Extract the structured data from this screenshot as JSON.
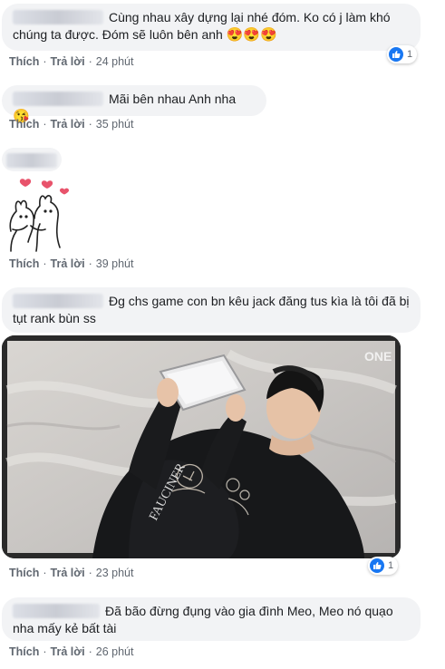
{
  "comments": [
    {
      "text": "Cùng nhau xây dựng lại nhé đóm. Ko có j làm khó chúng ta được. Đóm sẽ luôn bên anh",
      "emojis": "😍😍😍",
      "time": "24 phút",
      "reactions": "1"
    },
    {
      "text": "Mãi bên nhau Anh nha",
      "emojis": "😘",
      "time": "35 phút"
    },
    {
      "text": "",
      "time": "39 phút"
    },
    {
      "text": "Đg chs game con bn kêu jack đăng tus kìa là tôi đã bị tụt rank bùn ss",
      "time": "23 phút",
      "reactions": "1"
    },
    {
      "text": "Đã bão đừng đụng vào gia đình Meo, Meo nó quạo nha mấy kẻ bất tài",
      "time": "26 phút"
    }
  ],
  "actions": {
    "like": "Thích",
    "reply": "Trả lời",
    "sep": "·"
  },
  "video": {
    "watermark": "ONE",
    "shirt_text": "FAUCINER"
  },
  "colors": {
    "bubble": "#f2f3f5",
    "like_blue": "#1877f2",
    "meta": "#606770"
  }
}
